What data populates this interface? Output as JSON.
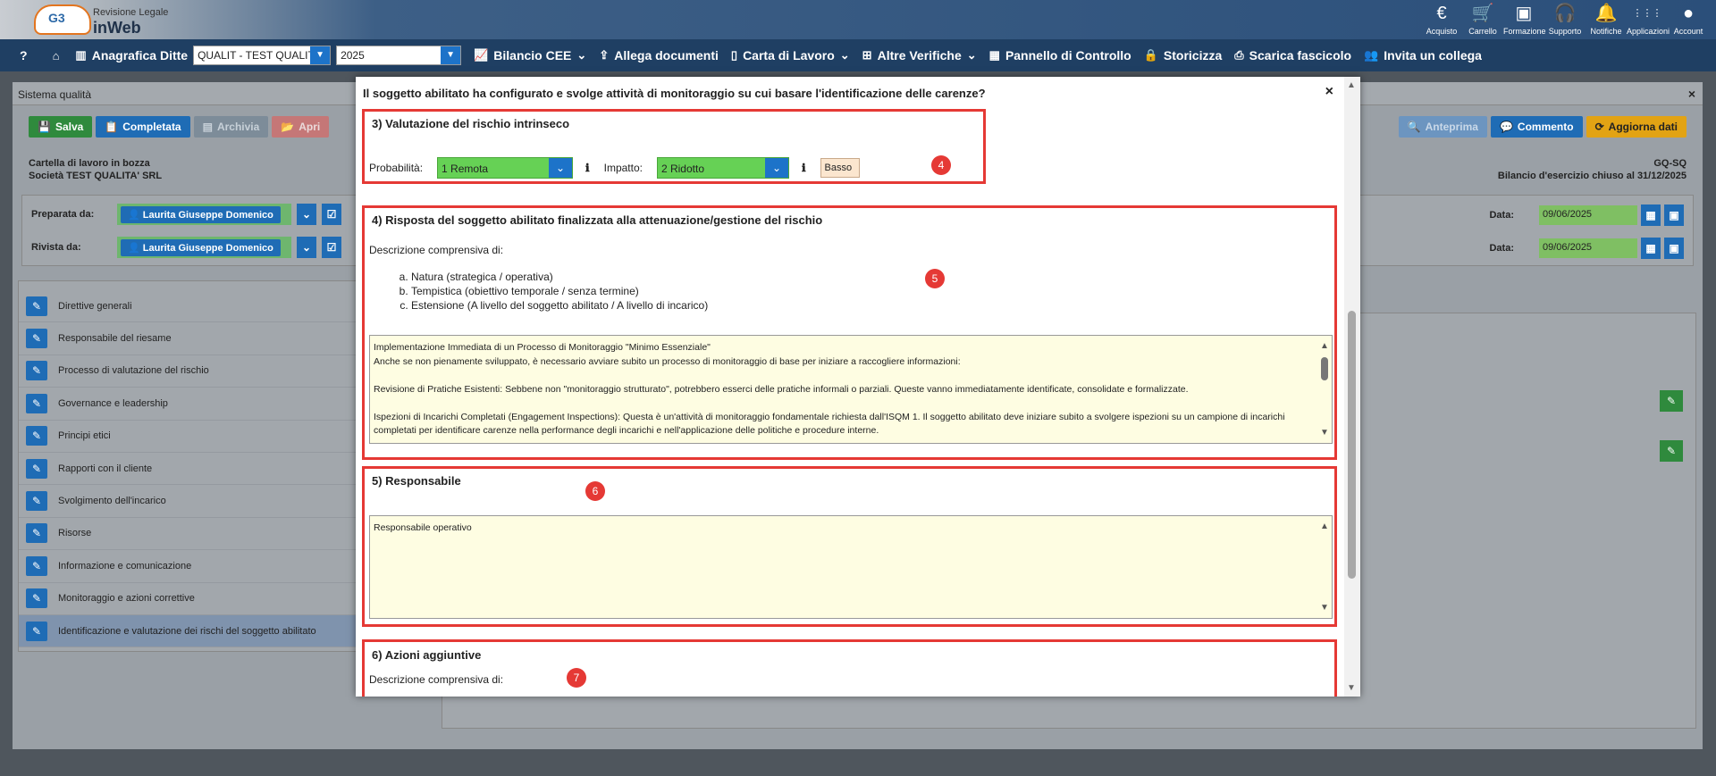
{
  "header": {
    "logo_line1": "Revisione Legale",
    "logo_line2": "inWeb",
    "logo_mark": "G3",
    "icons": [
      {
        "name": "euro-icon",
        "glyph": "€",
        "label": "Acquisto"
      },
      {
        "name": "cart-icon",
        "glyph": "🛒",
        "label": "Carrello"
      },
      {
        "name": "formazione-icon",
        "glyph": "▣",
        "label": "Formazione"
      },
      {
        "name": "headset-icon",
        "glyph": "🎧",
        "label": "Supporto"
      },
      {
        "name": "bell-icon",
        "glyph": "🔔",
        "label": "Notifiche"
      },
      {
        "name": "apps-grid-icon",
        "glyph": "⋮⋮⋮",
        "label": "Applicazioni"
      },
      {
        "name": "account-icon",
        "glyph": "●",
        "label": "Account"
      }
    ]
  },
  "nav": {
    "help": "?",
    "anagrafica": "Anagrafica Ditte",
    "company_select": "QUALIT - TEST QUALITA' S",
    "year_select": "2025",
    "bilancio": "Bilancio CEE",
    "allega": "Allega documenti",
    "carta": "Carta di Lavoro",
    "altre": "Altre Verifiche",
    "pannello": "Pannello di Controllo",
    "storicizza": "Storicizza",
    "scarica": "Scarica fascicolo",
    "invita": "Invita un collega"
  },
  "page": {
    "title": "Sistema qualità",
    "buttons_left": [
      "Salva",
      "Completata",
      "Archivia",
      "Apri"
    ],
    "buttons_right": [
      "Anteprima",
      "Commento",
      "Aggiorna dati"
    ],
    "status": "Cartella di lavoro in bozza",
    "company": "Società TEST QUALITA' SRL",
    "code": "GQ-SQ",
    "balance": "Bilancio d'esercizio chiuso al 31/12/2025",
    "prepared_label": "Preparata da:",
    "reviewed_label": "Rivista da:",
    "person": "Laurita Giuseppe Domenico",
    "date_label": "Data:",
    "date_value": "09/06/2025",
    "sidebar": [
      "Direttive generali",
      "Responsabile del riesame",
      "Processo di valutazione del rischio",
      "Governance e leadership",
      "Principi etici",
      "Rapporti con il cliente",
      "Svolgimento dell'incarico",
      "Risorse",
      "Informazione e comunicazione",
      "Monitoraggio e azioni correttive",
      "Identificazione e valutazione dei rischi del soggetto abilitato"
    ]
  },
  "modal": {
    "title": "Il soggetto abilitato ha configurato e svolge attività di monitoraggio su cui basare l'identificazione delle carenze?",
    "sec3": {
      "heading": "3) Valutazione del rischio intrinseco",
      "prob_label": "Probabilità:",
      "prob_value": "1 Remota",
      "impact_label": "Impatto:",
      "impact_value": "2 Ridotto",
      "result": "Basso",
      "badge": "4"
    },
    "sec4": {
      "heading": "4) Risposta del soggetto abilitato finalizzata alla attenuazione/gestione del rischio",
      "desc": "Descrizione comprensiva di:",
      "items": [
        "Natura (strategica / operativa)",
        "Tempistica (obiettivo temporale / senza termine)",
        "Estensione (A livello del soggetto abilitato / A livello di incarico)"
      ],
      "badge": "5",
      "text_lines": [
        "Implementazione Immediata di un Processo di Monitoraggio \"Minimo Essenziale\"",
        "Anche se non pienamente sviluppato, è necessario avviare subito un processo di monitoraggio di base per iniziare a raccogliere informazioni:",
        "",
        "Revisione di Pratiche Esistenti: Sebbene non \"monitoraggio strutturato\", potrebbero esserci delle pratiche informali o parziali. Queste vanno immediatamente identificate, consolidate e formalizzate.",
        "",
        "Ispezioni di Incarichi Completati (Engagement Inspections): Questa è un'attività di monitoraggio fondamentale richiesta dall'ISQM 1. Il soggetto abilitato deve iniziare subito a svolgere ispezioni su un campione di incarichi completati per identificare carenze nella performance degli incarichi e nell'applicazione delle politiche e procedure interne."
      ]
    },
    "sec5": {
      "heading": "5) Responsabile",
      "value": "Responsabile operativo",
      "badge": "6"
    },
    "sec6": {
      "heading": "6) Azioni aggiuntive",
      "desc": "Descrizione comprensiva di:",
      "badge": "7"
    }
  }
}
